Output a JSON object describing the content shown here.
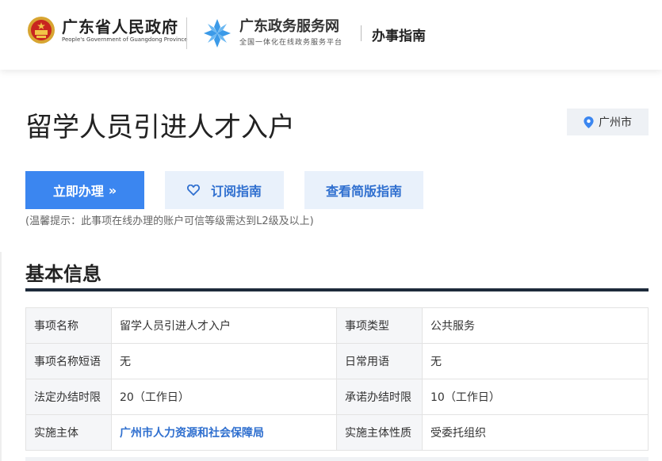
{
  "header": {
    "gov_title": "广东省人民政府",
    "gov_subtitle": "People's Government of Guangdong Province",
    "service_title": "广东政务服务网",
    "service_subtitle": "全国一体化在线政务服务平台",
    "nav_title": "办事指南"
  },
  "page": {
    "title": "留学人员引进人才入户",
    "location": "广州市"
  },
  "actions": {
    "apply_label": "立即办理",
    "apply_icon": "»",
    "subscribe_label": "订阅指南",
    "simple_label": "查看简版指南",
    "tip": "(温馨提示：此事项在线办理的账户可信等级需达到L2级及以上)"
  },
  "basic_info": {
    "title": "基本信息",
    "rows": [
      {
        "k1": "事项名称",
        "v1": "留学人员引进人才入户",
        "k2": "事项类型",
        "v2": "公共服务"
      },
      {
        "k1": "事项名称短语",
        "v1": "无",
        "k2": "日常用语",
        "v2": "无"
      },
      {
        "k1": "法定办结时限",
        "v1": "20（工作日）",
        "k2": "承诺办结时限",
        "v2": "10（工作日）"
      },
      {
        "k1": "实施主体",
        "v1": "广州市人力资源和社会保障局",
        "k2": "实施主体性质",
        "v2": "受委托组织"
      }
    ]
  },
  "colors": {
    "primary": "#3b86f0",
    "link": "#2f6fcf",
    "section_bar": "#1d2a3a"
  }
}
